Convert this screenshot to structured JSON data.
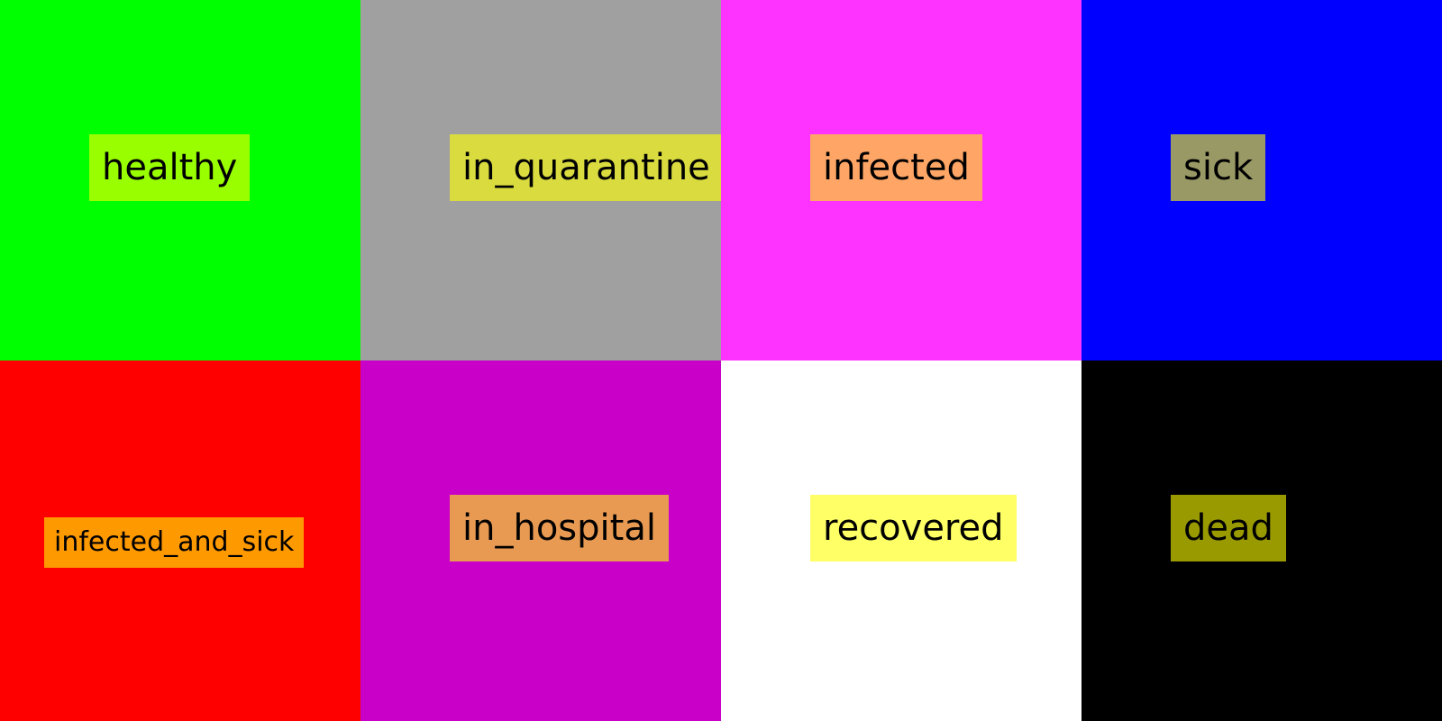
{
  "cells": [
    {
      "label": "healthy",
      "cell_color": "#00ff00",
      "label_color": "#99ff00"
    },
    {
      "label": "in_quarantine",
      "cell_color": "#a0a0a0",
      "label_color": "#d9db3f"
    },
    {
      "label": "infected",
      "cell_color": "#ff33ff",
      "label_color": "#ffa666"
    },
    {
      "label": "sick",
      "cell_color": "#0000ff",
      "label_color": "#999966"
    },
    {
      "label": "infected_and_sick",
      "cell_color": "#ff0000",
      "label_color": "#ff9900"
    },
    {
      "label": "in_hospital",
      "cell_color": "#c800c8",
      "label_color": "#e89a52"
    },
    {
      "label": "recovered",
      "cell_color": "#ffffff",
      "label_color": "#ffff66"
    },
    {
      "label": "dead",
      "cell_color": "#000000",
      "label_color": "#999900"
    }
  ]
}
